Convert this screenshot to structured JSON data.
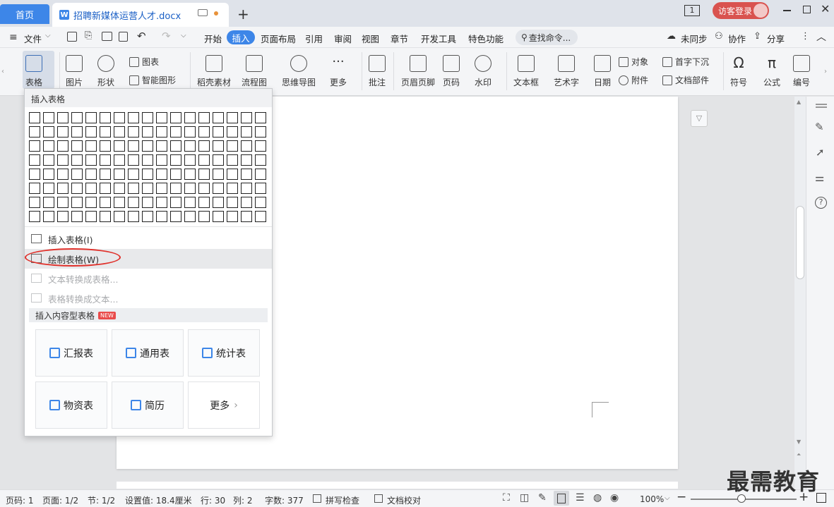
{
  "titlebar": {
    "home_tab": "首页",
    "doc_tab_title": "招聘新媒体运营人才.docx",
    "doc_tab_icon": "W",
    "new_tab": "+",
    "page_badge": "1",
    "login_button": "访客登录"
  },
  "menubar": {
    "file": "文件",
    "tabs": [
      "开始",
      "插入",
      "页面布局",
      "引用",
      "审阅",
      "视图",
      "章节",
      "开发工具",
      "特色功能"
    ],
    "active_tab": "插入",
    "search_placeholder": "查找命令...",
    "sync": "未同步",
    "collab": "协作",
    "share": "分享"
  },
  "ribbon": {
    "table": "表格",
    "picture": "图片",
    "shape": "形状",
    "chart": "图表",
    "smart_shape": "智能图形",
    "shell_material": "稻壳素材",
    "flowchart": "流程图",
    "mindmap": "思维导图",
    "more": "更多",
    "comment": "批注",
    "header_footer": "页眉页脚",
    "page_number": "页码",
    "watermark": "水印",
    "textbox": "文本框",
    "wordart": "艺术字",
    "date": "日期",
    "object": "对象",
    "attachment": "附件",
    "dropcap": "首字下沉",
    "doc_parts": "文档部件",
    "symbol": "符号",
    "formula": "公式",
    "numbering": "编号"
  },
  "dropdown": {
    "header": "插入表格",
    "insert_table": "插入表格(I)",
    "draw_table": "绘制表格(W)",
    "text_to_table": "文本转换成表格...",
    "table_to_text": "表格转换成文本...",
    "content_tables_header": "插入内容型表格",
    "new_badge": "NEW",
    "cards": [
      "汇报表",
      "通用表",
      "统计表",
      "物资表",
      "简历",
      "更多"
    ]
  },
  "statusbar": {
    "page_code": "页码: 1",
    "pages": "页面: 1/2",
    "section": "节: 1/2",
    "setting": "设置值: 18.4厘米",
    "row": "行: 30",
    "col": "列: 2",
    "word_count": "字数: 377",
    "spell_check": "拼写检查",
    "doc_proof": "文档校对",
    "zoom": "100%"
  },
  "watermark_text": "最需教育",
  "colors": {
    "accent": "#3d86e8",
    "login": "#d9534f",
    "highlight_oval": "#e0302a"
  }
}
